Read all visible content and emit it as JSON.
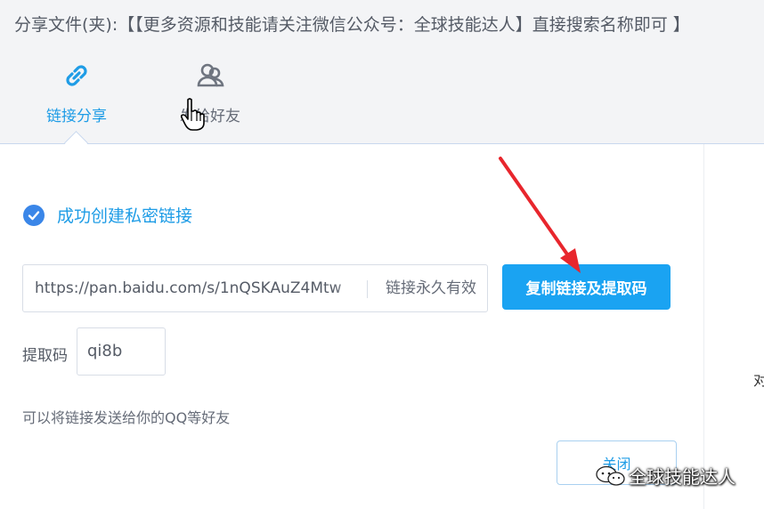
{
  "dialog": {
    "share_title": "分享文件(夹):【【更多资源和技能请关注微信公众号：全球技能达人】直接搜索名称即可 】"
  },
  "tabs": [
    {
      "label": "链接分享",
      "icon": "link-icon",
      "active": true
    },
    {
      "label": "发给好友",
      "icon": "friends-icon",
      "active": false
    }
  ],
  "success": {
    "text": "成功创建私密链接",
    "icon": "check-circle-icon"
  },
  "link": {
    "url": "https://pan.baidu.com/s/1nQSKAuZ4Mtw",
    "validity": "链接永久有效"
  },
  "copy_button": {
    "label": "复制链接及提取码"
  },
  "extraction": {
    "label": "提取码",
    "code": "qi8b"
  },
  "hint": "可以将链接发送给你的QQ等好友",
  "close_button": {
    "label": "关闭"
  },
  "watermark": {
    "text": "全球技能达人"
  },
  "right_edge": {
    "char": "对"
  },
  "colors": {
    "accent": "#1e9ce6",
    "button_bg": "#1aa3f2",
    "check": "#3a86e8",
    "annotation_arrow": "#e8262d"
  }
}
